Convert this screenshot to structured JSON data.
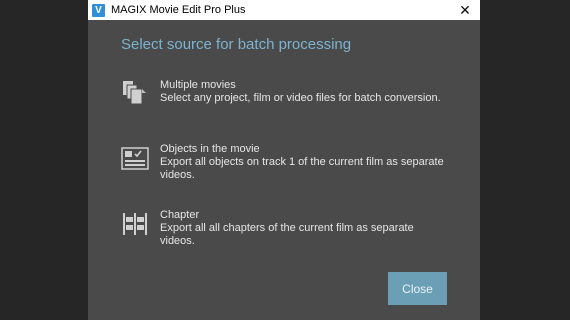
{
  "window": {
    "title": "MAGIX Movie Edit Pro Plus",
    "app_icon": "V",
    "close_glyph": "✕"
  },
  "dialog": {
    "heading": "Select source for batch processing",
    "options": [
      {
        "icon": "multiple-files-icon",
        "title": "Multiple movies",
        "description": "Select any project, film or video files for batch conversion."
      },
      {
        "icon": "objects-track-icon",
        "title": "Objects in the movie",
        "description": "Export all objects on track 1 of the current film as separate videos."
      },
      {
        "icon": "chapter-icon",
        "title": "Chapter",
        "description": "Export all all chapters of the current film as separate videos."
      }
    ],
    "close_label": "Close"
  },
  "colors": {
    "accent": "#7db3cf",
    "button": "#6a9fb5",
    "dialog_bg": "#4a4a4a"
  }
}
